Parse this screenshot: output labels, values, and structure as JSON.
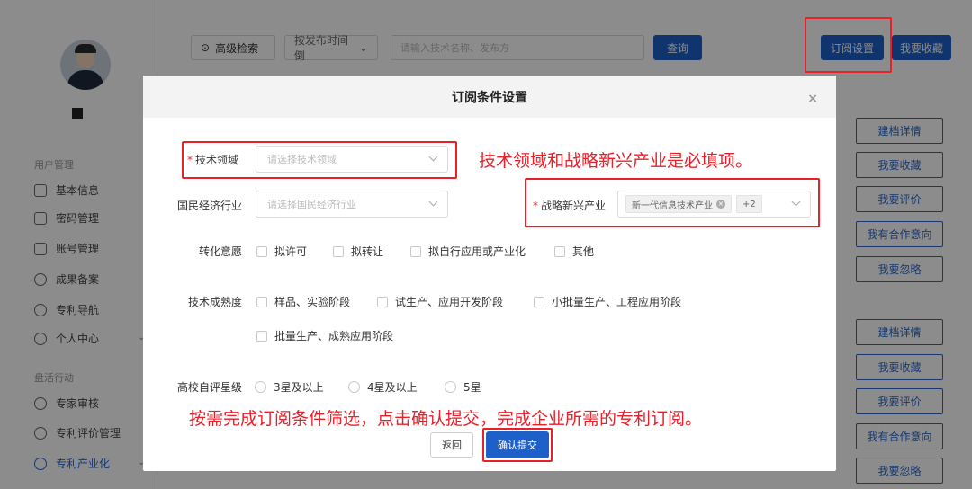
{
  "topbar": {
    "advanced_search": "高级检索",
    "sort_select": "按发布时间倒",
    "search_placeholder": "请输入技术名称、发布方",
    "query_button": "查询",
    "subscribe_settings": "订阅设置",
    "my_favorites": "我要收藏"
  },
  "sidebar": {
    "group1": "用户管理",
    "items1": [
      "基本信息",
      "密码管理",
      "账号管理",
      "成果备案",
      "专利导航",
      "个人中心"
    ],
    "group2": "盘活行动",
    "items2": [
      "专家审核",
      "专利评价管理",
      "专利产业化"
    ]
  },
  "right_actions": [
    "建档详情",
    "我要收藏",
    "我要评价",
    "我有合作意向",
    "我要忽略",
    "建档详情",
    "我要收藏",
    "我要评价",
    "我有合作意向",
    "我要忽略"
  ],
  "modal": {
    "title": "订阅条件设置",
    "close": "×",
    "tech_field_label": "技术领域",
    "tech_field_placeholder": "请选择技术领域",
    "economy_label": "国民经济行业",
    "economy_placeholder": "请选择国民经济行业",
    "strategic_label": "战略新兴产业",
    "strategic_tag": "新一代信息技术产业",
    "strategic_more": "+2",
    "transfer_label": "转化意愿",
    "transfer_options": [
      "拟许可",
      "拟转让",
      "拟自行应用或产业化",
      "其他"
    ],
    "maturity_label": "技术成熟度",
    "maturity_options": [
      "样品、实验阶段",
      "试生产、应用开发阶段",
      "小批量生产、工程应用阶段",
      "批量生产、成熟应用阶段"
    ],
    "rating_label": "高校自评星级",
    "rating_options": [
      "3星及以上",
      "4星及以上",
      "5星"
    ],
    "back_button": "返回",
    "submit_button": "确认提交"
  },
  "annotations": {
    "required_note": "技术领域和战略新兴产业是必填项。",
    "submit_note": "按需完成订阅条件筛选，点击确认提交，完成企业所需的专利订阅。"
  },
  "colors": {
    "accent": "#1e60c7",
    "annotation": "#e8202a"
  }
}
